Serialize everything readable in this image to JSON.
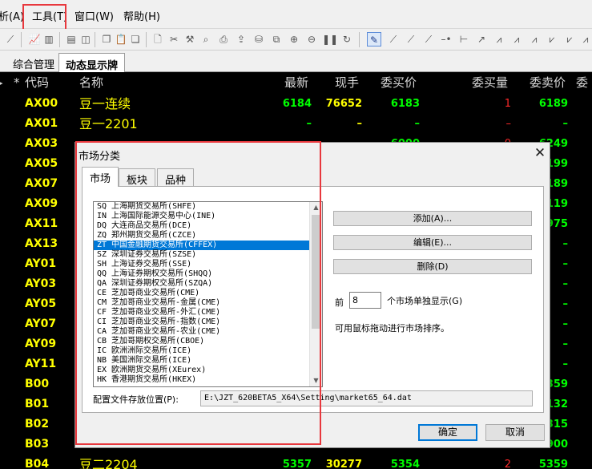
{
  "menubar": {
    "items": [
      {
        "label": "析(A)"
      },
      {
        "label": "工具(T)"
      },
      {
        "label": "窗口(W)"
      },
      {
        "label": "帮助(H)"
      }
    ]
  },
  "tabs": [
    {
      "label": "综合管理"
    },
    {
      "label": "动态显示牌"
    }
  ],
  "quote_table": {
    "headers": [
      "*",
      "代码",
      "名称",
      "最新",
      "现手",
      "委买价",
      "委买量",
      "委卖价"
    ],
    "rows": [
      {
        "code": "AX00",
        "name": "豆一连续",
        "latest": "6184",
        "vol": "76652",
        "bid": "6183",
        "bid_vol": "1",
        "ask": "6189"
      },
      {
        "code": "AX01",
        "name": "豆一2201",
        "latest": "–",
        "vol": "–",
        "bid": "–",
        "bid_vol": "–",
        "ask": "–"
      },
      {
        "code": "AX03",
        "name": "",
        "latest": "",
        "vol": "",
        "bid": "6000",
        "bid_vol": "0",
        "ask": "6249"
      },
      {
        "code": "AX05",
        "name": "",
        "latest": "",
        "vol": "",
        "bid": "",
        "bid_vol": "",
        "ask": "199"
      },
      {
        "code": "AX07",
        "name": "",
        "latest": "",
        "vol": "",
        "bid": "",
        "bid_vol": "",
        "ask": "189"
      },
      {
        "code": "AX09",
        "name": "",
        "latest": "",
        "vol": "",
        "bid": "",
        "bid_vol": "",
        "ask": "119"
      },
      {
        "code": "AX11",
        "name": "",
        "latest": "",
        "vol": "",
        "bid": "",
        "bid_vol": "",
        "ask": "975"
      },
      {
        "code": "AX13",
        "name": "",
        "latest": "",
        "vol": "",
        "bid": "",
        "bid_vol": "",
        "ask": "–"
      },
      {
        "code": "AY01",
        "name": "",
        "latest": "",
        "vol": "",
        "bid": "",
        "bid_vol": "",
        "ask": "–"
      },
      {
        "code": "AY03",
        "name": "",
        "latest": "",
        "vol": "",
        "bid": "",
        "bid_vol": "",
        "ask": "–"
      },
      {
        "code": "AY05",
        "name": "",
        "latest": "",
        "vol": "",
        "bid": "",
        "bid_vol": "",
        "ask": "–"
      },
      {
        "code": "AY07",
        "name": "",
        "latest": "",
        "vol": "",
        "bid": "",
        "bid_vol": "",
        "ask": "–"
      },
      {
        "code": "AY09",
        "name": "",
        "latest": "",
        "vol": "",
        "bid": "",
        "bid_vol": "",
        "ask": "–"
      },
      {
        "code": "AY11",
        "name": "",
        "latest": "",
        "vol": "",
        "bid": "",
        "bid_vol": "",
        "ask": "–"
      },
      {
        "code": "B00",
        "name": "",
        "latest": "",
        "vol": "",
        "bid": "",
        "bid_vol": "",
        "ask": "359"
      },
      {
        "code": "B01",
        "name": "",
        "latest": "",
        "vol": "",
        "bid": "",
        "bid_vol": "",
        "ask": "132"
      },
      {
        "code": "B02",
        "name": "",
        "latest": "",
        "vol": "",
        "bid": "",
        "bid_vol": "",
        "ask": "315"
      },
      {
        "code": "B03",
        "name": "",
        "latest": "",
        "vol": "",
        "bid": "",
        "bid_vol": "",
        "ask": "900"
      },
      {
        "code": "B04",
        "name": "豆二2204",
        "latest": "5357",
        "vol": "30277",
        "bid": "5354",
        "bid_vol": "2",
        "ask": "5359"
      }
    ]
  },
  "dialog": {
    "title": "市场分类",
    "close_glyph": "✕",
    "tabs": [
      "市场",
      "板块",
      "品种"
    ],
    "markets": [
      "SQ 上海期货交易所(SHFE)",
      "IN 上海国际能源交易中心(INE)",
      "DQ 大连商品交易所(DCE)",
      "ZQ 郑州期货交易所(CZCE)",
      "ZT 中国金融期货交易所(CFFEX)",
      "SZ 深圳证券交易所(SZSE)",
      "SH 上海证券交易所(SSE)",
      "QQ 上海证券期权交易所(SHQQ)",
      "QA 深圳证券期权交易所(SZQA)",
      "CE 芝加哥商业交易所(CME)",
      "CM 芝加哥商业交易所-金属(CME)",
      "CF 芝加哥商业交易所-外汇(CME)",
      "CI 芝加哥商业交易所-指数(CME)",
      "CA 芝加哥商业交易所-农业(CME)",
      "CB 芝加哥期权交易所(CBOE)",
      "IC 欧洲洲际交易所(ICE)",
      "NB 美国洲际交易所(ICE)",
      "EX 欧洲期货交易所(XEurex)",
      "HK 香港期货交易所(HKEX)"
    ],
    "selected_market": "ZT 中国金融期货交易所(CFFEX)",
    "buttons": {
      "add": "添加(A)...",
      "edit": "编辑(E)...",
      "delete": "删除(D)"
    },
    "front_label": "前",
    "front_value": "8",
    "front_suffix": "个市场单独显示(G)",
    "drag_hint": "可用鼠标拖动进行市场排序。",
    "path_label": "配置文件存放位置(P):",
    "path_value": "E:\\JZT_620BETA5_X64\\Setting\\market65_64.dat",
    "ok": "确定",
    "cancel": "取消"
  },
  "colors": {
    "highlight_box": "#e8383d",
    "code_yellow": "#ffff00",
    "value_green": "#00ff00",
    "value_red": "#ff2a2a",
    "selection_blue": "#0078d7"
  }
}
